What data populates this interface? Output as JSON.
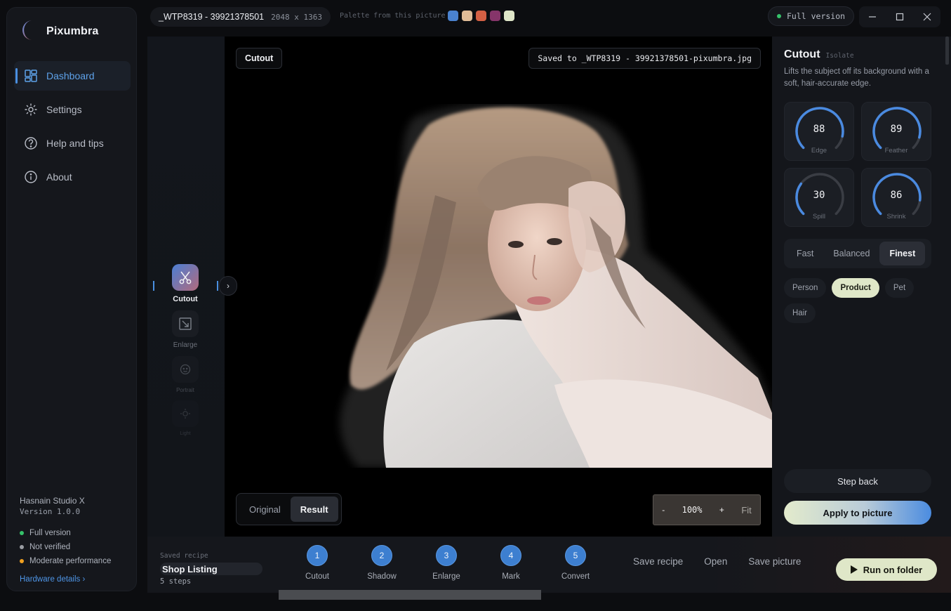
{
  "app": {
    "name": "Pixumbra"
  },
  "nav": [
    {
      "label": "Dashboard",
      "icon": "dashboard-icon",
      "active": true
    },
    {
      "label": "Settings",
      "icon": "settings-icon",
      "active": false
    },
    {
      "label": "Help and tips",
      "icon": "help-icon",
      "active": false
    },
    {
      "label": "About",
      "icon": "info-icon",
      "active": false
    }
  ],
  "footer": {
    "studio": "Hasnain Studio X",
    "version": "Version 1.0.0",
    "statuses": [
      {
        "label": "Full version",
        "color": "#35c26a"
      },
      {
        "label": "Not verified",
        "color": "#9a9da3"
      },
      {
        "label": "Moderate performance",
        "color": "#f0a020"
      }
    ],
    "hardware_link": "Hardware details ›"
  },
  "file": {
    "name": "_WTP8319 - 39921378501",
    "dimensions": "2048 x 1363"
  },
  "palette": {
    "label": "Palette from this picture",
    "colors": [
      "#4a82cf",
      "#e0bc98",
      "#d46044",
      "#86356a",
      "#dfe6c8"
    ]
  },
  "license_badge": "Full version",
  "tools": [
    {
      "label": "Cutout",
      "icon": "cutout-icon",
      "active": true
    },
    {
      "label": "Enlarge",
      "icon": "enlarge-icon",
      "active": false
    },
    {
      "label": "Portrait",
      "icon": "portrait-icon",
      "active": false
    },
    {
      "label": "Light",
      "icon": "light-icon",
      "active": false
    }
  ],
  "canvas": {
    "tool_tag": "Cutout",
    "saved_text": "Saved to _WTP8319 - 39921378501-pixumbra.jpg",
    "view_toggle": {
      "options": [
        "Original",
        "Result"
      ],
      "selected": "Result"
    },
    "zoom": {
      "minus": "-",
      "level": "100%",
      "plus": "+",
      "fit": "Fit"
    }
  },
  "panel": {
    "title": "Cutout",
    "subtitle": "Isolate",
    "description": "Lifts the subject off its background with a soft, hair-accurate edge.",
    "dials": [
      {
        "label": "Edge",
        "value": "88",
        "fraction": 0.88
      },
      {
        "label": "Feather",
        "value": "89",
        "fraction": 0.89
      },
      {
        "label": "Spill",
        "value": "30",
        "fraction": 0.3
      },
      {
        "label": "Shrink",
        "value": "86",
        "fraction": 0.86
      }
    ],
    "quality": {
      "options": [
        "Fast",
        "Balanced",
        "Finest"
      ],
      "selected": "Finest"
    },
    "subjects": {
      "options": [
        "Person",
        "Product",
        "Pet",
        "Hair"
      ],
      "selected": "Product"
    },
    "step_back": "Step back",
    "apply": "Apply to picture"
  },
  "bottom": {
    "recipe_label": "Saved recipe",
    "recipe_name": "Shop Listing",
    "recipe_steps": "5 steps",
    "steps": [
      {
        "num": "1",
        "label": "Cutout"
      },
      {
        "num": "2",
        "label": "Shadow"
      },
      {
        "num": "3",
        "label": "Enlarge"
      },
      {
        "num": "4",
        "label": "Mark"
      },
      {
        "num": "5",
        "label": "Convert"
      }
    ],
    "actions": [
      "Save recipe",
      "Open",
      "Save picture"
    ],
    "run": "Run on folder"
  }
}
